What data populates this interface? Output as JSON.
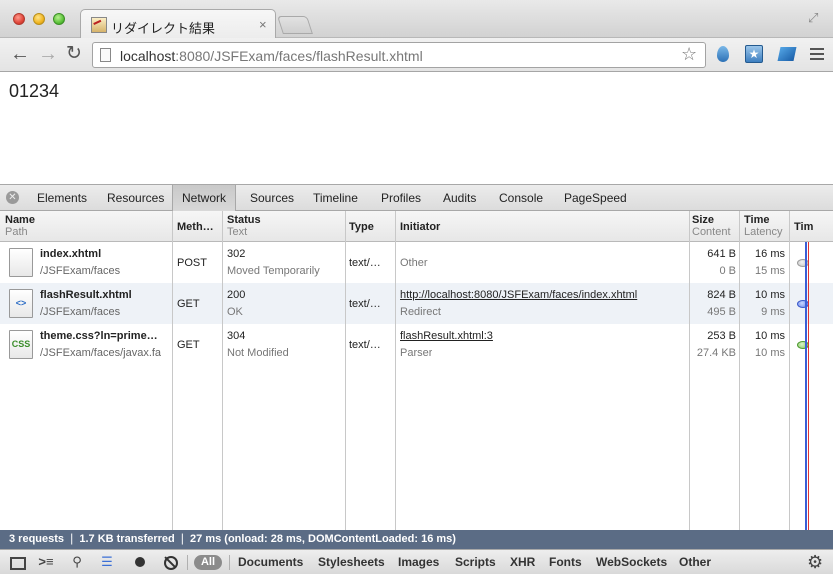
{
  "browser": {
    "tab_title": "リダイレクト結果",
    "tab_close": "×",
    "url_host": "localhost",
    "url_rest": ":8080/JSFExam/faces/flashResult.xhtml"
  },
  "page": {
    "text": "01234"
  },
  "devtools": {
    "tabs": [
      "Elements",
      "Resources",
      "Network",
      "Sources",
      "Timeline",
      "Profiles",
      "Audits",
      "Console",
      "PageSpeed"
    ],
    "active_tab": "Network",
    "columns": {
      "name": "Name",
      "path": "Path",
      "method": "Meth…",
      "status": "Status",
      "status_text": "Text",
      "type": "Type",
      "initiator": "Initiator",
      "size": "Size",
      "content": "Content",
      "time": "Time",
      "latency": "Latency",
      "timeline": "Tim"
    },
    "requests": [
      {
        "icon": "",
        "name": "index.xhtml",
        "path": "/JSFExam/faces",
        "method": "POST",
        "status": "302",
        "status_text": "Moved Temporarily",
        "type": "text/…",
        "initiator": "Other",
        "initiator_sub": "",
        "size": "641 B",
        "content": "0 B",
        "time": "16 ms",
        "latency": "15 ms"
      },
      {
        "icon": "<>",
        "name": "flashResult.xhtml",
        "path": "/JSFExam/faces",
        "method": "GET",
        "status": "200",
        "status_text": "OK",
        "type": "text/…",
        "initiator": "http://localhost:8080/JSFExam/faces/index.xhtml",
        "initiator_sub": "Redirect",
        "size": "824 B",
        "content": "495 B",
        "time": "10 ms",
        "latency": "9 ms"
      },
      {
        "icon": "CSS",
        "name": "theme.css?ln=prime…",
        "path": "/JSFExam/faces/javax.fa",
        "method": "GET",
        "status": "304",
        "status_text": "Not Modified",
        "type": "text/…",
        "initiator": "flashResult.xhtml:3",
        "initiator_sub": "Parser",
        "size": "253 B",
        "content": "27.4 KB",
        "time": "10 ms",
        "latency": "10 ms"
      }
    ],
    "summary": "3 requests  ❘  1.7 KB transferred  ❘  27 ms (onload: 28 ms, DOMContentLoaded: 16 ms)",
    "filters": [
      "All",
      "Documents",
      "Stylesheets",
      "Images",
      "Scripts",
      "XHR",
      "Fonts",
      "WebSockets",
      "Other"
    ]
  }
}
